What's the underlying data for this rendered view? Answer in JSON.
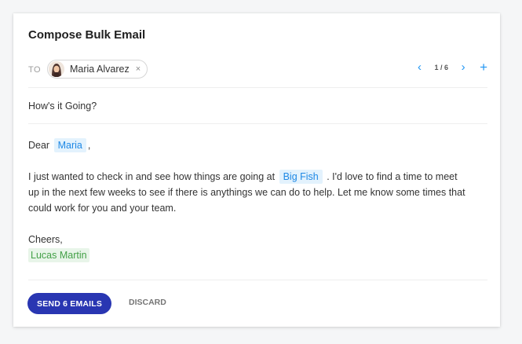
{
  "compose": {
    "title": "Compose Bulk Email",
    "to_label": "TO",
    "recipient": {
      "name": "Maria Alvarez",
      "remove_glyph": "×",
      "avatar_icon": "person-avatar"
    },
    "pagination": {
      "prev_glyph": "‹",
      "count": "1 / 6",
      "next_glyph": "›",
      "add_glyph": "+"
    },
    "subject": "How's it Going?",
    "body": {
      "greeting_prefix": "Dear",
      "greeting_name": "Maria",
      "greeting_suffix": ",",
      "p1_before": "I just wanted to check in and see how things are going at",
      "company": "Big Fish",
      "p1_after": ". I'd love to find a time to meet up in the next few weeks to see if there is anythings we can do to help. Let me know some times that could work for you and your team.",
      "signoff": "Cheers,",
      "signature": "Lucas Martin"
    },
    "footer": {
      "send_label": "SEND 6 EMAILS",
      "discard_label": "DISCARD"
    }
  },
  "colors": {
    "accent": "#2196f3",
    "send_button": "#2936b2",
    "merge_tag_bg": "#e3f2fd",
    "signature_bg": "#e8f5e9"
  }
}
